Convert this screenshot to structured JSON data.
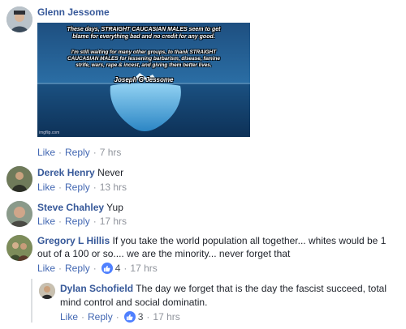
{
  "comments": [
    {
      "author": "Glenn Jessome",
      "text": "",
      "actions": {
        "like": "Like",
        "reply": "Reply",
        "time": "7 hrs"
      },
      "image": {
        "line1": "These days, STRAIGHT CAUCASIAN MALES seem to get blame for everything bad and no credit for any good.",
        "line2": "I'm still waiting for many other groups, to thank STRAIGHT CAUCASIAN MALES for lessening barbarism, disease, famine strife, wars, rape & incest, and giving them better lives.",
        "signature": "Joseph G Jessome",
        "watermark": "imgflip.com"
      }
    },
    {
      "author": "Derek Henry",
      "text": "Never",
      "actions": {
        "like": "Like",
        "reply": "Reply",
        "time": "13 hrs"
      }
    },
    {
      "author": "Steve Chahley",
      "text": "Yup",
      "actions": {
        "like": "Like",
        "reply": "Reply",
        "time": "17 hrs"
      }
    },
    {
      "author": "Gregory L Hillis",
      "text": "If you take the world population all together... whites would be 1 out of a 100 or so.... we are the minority... never forget that",
      "actions": {
        "like": "Like",
        "reply": "Reply",
        "reactions": "4",
        "time": "17 hrs"
      }
    },
    {
      "author": "Dylan Schofield",
      "text": "The day we forget that is the day the fascist succeed, total mind control and social dominatin.",
      "actions": {
        "like": "Like",
        "reply": "Reply",
        "reactions": "3",
        "time": "17 hrs"
      }
    }
  ],
  "ui": {
    "separator": "·",
    "link_color": "#4267b2",
    "name_color": "#365899",
    "meta_color": "#90949c",
    "like_color": "#4f80ff"
  }
}
